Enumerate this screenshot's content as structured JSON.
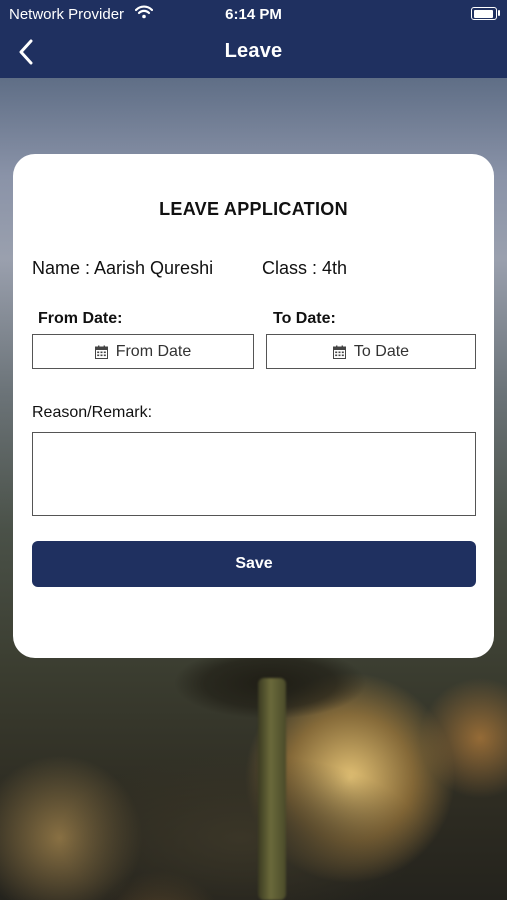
{
  "status_bar": {
    "carrier": "Network Provider",
    "time": "6:14 PM",
    "battery_level": 0.95
  },
  "header": {
    "title": "Leave"
  },
  "form": {
    "title": "LEAVE APPLICATION",
    "name_text": "Name : Aarish Qureshi",
    "class_text": "Class : 4th",
    "from_label": "From Date:",
    "from_placeholder": "From Date",
    "to_label": "To Date:",
    "to_placeholder": "To Date",
    "reason_label": "Reason/Remark:",
    "reason_value": "",
    "save_label": "Save"
  },
  "colors": {
    "header_bg": "#1f3060",
    "button_bg": "#1f3060",
    "card_bg": "#ffffff"
  },
  "icons": [
    "wifi-icon",
    "battery-icon",
    "back-chevron-icon",
    "calendar-icon"
  ]
}
